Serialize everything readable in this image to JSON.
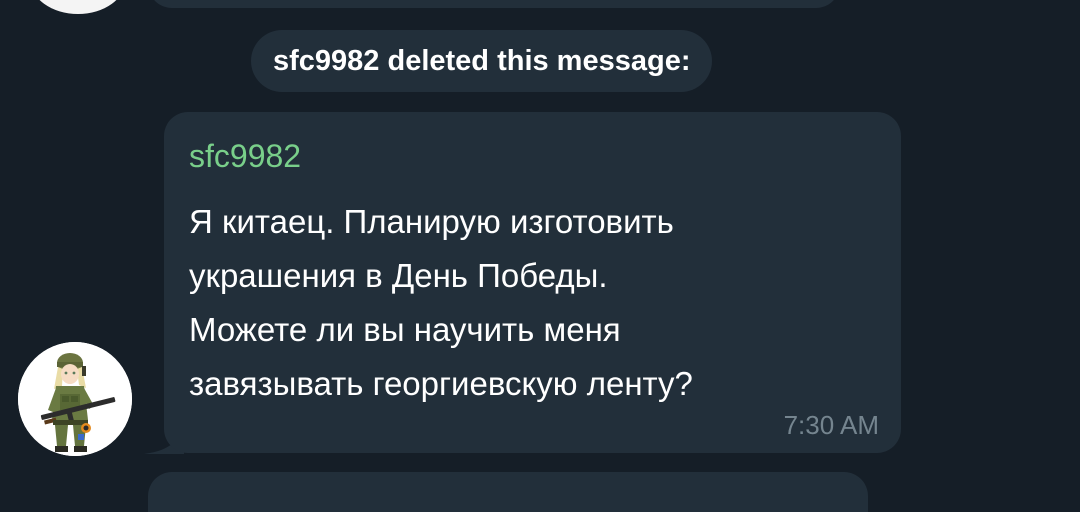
{
  "service": {
    "deleted_notice": "sfc9982 deleted this message:"
  },
  "message": {
    "sender": "sfc9982",
    "text": "Я китаец. Планирую изготовить\nукрашения в День Победы.\nМожете ли вы научить меня\nзавязывать георгиевскую ленту?",
    "time": "7:30 AM"
  },
  "icons": {
    "avatar": "soldier-avatar-icon"
  },
  "colors": {
    "background": "#151e27",
    "bubble": "#222f3a",
    "sender_name": "#79cf8a",
    "timestamp": "#75858f",
    "text": "#ffffff"
  }
}
